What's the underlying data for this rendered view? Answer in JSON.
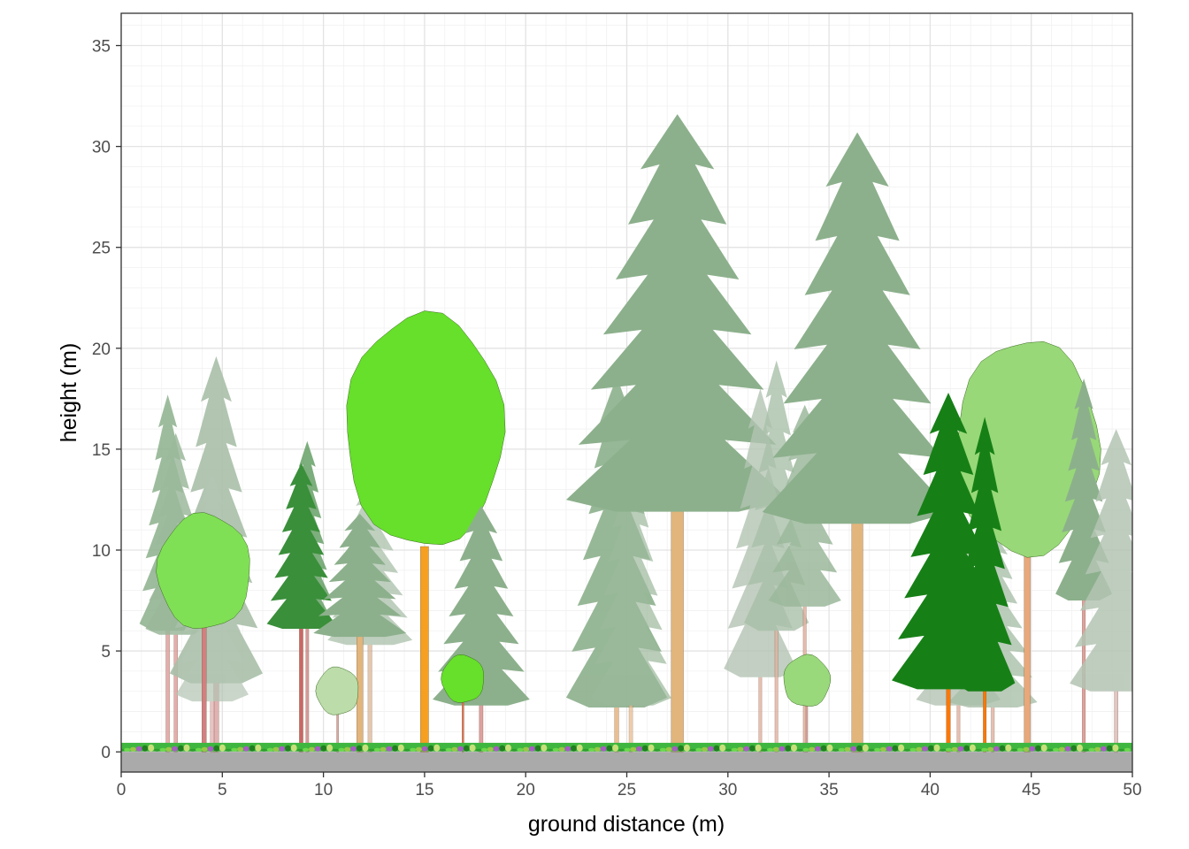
{
  "chart_data": {
    "type": "scatter",
    "title": "",
    "xlabel": "ground distance (m)",
    "ylabel": "height (m)",
    "xlim": [
      0,
      50
    ],
    "ylim": [
      -1,
      36.6
    ],
    "xticks": [
      0,
      5,
      10,
      15,
      20,
      25,
      30,
      35,
      40,
      45,
      50
    ],
    "yticks": [
      0,
      5,
      10,
      15,
      20,
      25,
      30,
      35
    ],
    "grid": true,
    "legend": "none",
    "ground": {
      "color": "#aaaaaa",
      "from": -1,
      "to": 0
    },
    "trees": [
      {
        "kind": "conifer",
        "x": 2.3,
        "h": 17.7,
        "crown_base": 6.0,
        "crown_w": 2.8,
        "color": "#8cb08c",
        "trunk": "#e0a0a0",
        "dbh": 0.18,
        "opacity": 0.85
      },
      {
        "kind": "conifer",
        "x": 2.7,
        "h": 15.8,
        "crown_base": 5.8,
        "crown_w": 3.0,
        "color": "#9bb89b",
        "trunk": "#e0a0a0",
        "dbh": 0.18,
        "opacity": 0.85
      },
      {
        "kind": "conifer",
        "x": 4.7,
        "h": 19.6,
        "crown_base": 3.4,
        "crown_w": 4.6,
        "color": "#a9bfa9",
        "trunk": "#ddaaaa",
        "dbh": 0.25,
        "opacity": 0.9
      },
      {
        "kind": "conifer",
        "x": 4.5,
        "h": 13.8,
        "crown_base": 2.5,
        "crown_w": 3.6,
        "color": "#b3c4b3",
        "trunk": "#ddaaaa",
        "dbh": 0.2,
        "opacity": 0.7
      },
      {
        "kind": "broadleaf",
        "x": 4.1,
        "h": 11.8,
        "crown_base": 6.0,
        "crown_w": 4.6,
        "color": "#80e055",
        "trunk": "#d08080",
        "dbh": 0.22,
        "opacity": 1
      },
      {
        "kind": "conifer",
        "x": 9.2,
        "h": 15.4,
        "crown_base": 6.2,
        "crown_w": 2.5,
        "color": "#5d9a5d",
        "trunk": "#cc8080",
        "dbh": 0.15,
        "opacity": 0.8
      },
      {
        "kind": "conifer",
        "x": 8.9,
        "h": 14.3,
        "crown_base": 6.1,
        "crown_w": 3.4,
        "color": "#3a8f3a",
        "trunk": "#cc6666",
        "dbh": 0.18,
        "opacity": 1
      },
      {
        "kind": "conifer",
        "x": 12.3,
        "h": 13.3,
        "crown_base": 5.3,
        "crown_w": 4.2,
        "color": "#a4bca4",
        "trunk": "#d9b090",
        "dbh": 0.2,
        "opacity": 0.7
      },
      {
        "kind": "conifer",
        "x": 11.8,
        "h": 11.8,
        "crown_base": 5.7,
        "crown_w": 4.6,
        "color": "#8cb08c",
        "trunk": "#e2b57c",
        "dbh": 0.3,
        "opacity": 1
      },
      {
        "kind": "broadleaf",
        "x": 10.7,
        "h": 4.2,
        "crown_base": 1.8,
        "crown_w": 2.1,
        "color": "#bcdcaa",
        "trunk": "#d8a8a8",
        "dbh": 0.08,
        "opacity": 1
      },
      {
        "kind": "broadleaf",
        "x": 15.0,
        "h": 21.7,
        "crown_base": 10.0,
        "crown_w": 7.8,
        "color": "#66e02a",
        "trunk": "#f5a020",
        "dbh": 0.4,
        "opacity": 1
      },
      {
        "kind": "conifer",
        "x": 17.8,
        "h": 12.2,
        "crown_base": 2.3,
        "crown_w": 4.8,
        "color": "#8cb08c",
        "trunk": "#e0a0a0",
        "dbh": 0.18,
        "opacity": 1
      },
      {
        "kind": "broadleaf",
        "x": 16.9,
        "h": 4.8,
        "crown_base": 2.4,
        "crown_w": 2.1,
        "color": "#66e02a",
        "trunk": "#e07050",
        "dbh": 0.08,
        "opacity": 1
      },
      {
        "kind": "conifer",
        "x": 24.5,
        "h": 18.6,
        "crown_base": 2.2,
        "crown_w": 5.0,
        "color": "#8cb08c",
        "trunk": "#e8b888",
        "dbh": 0.2,
        "opacity": 0.9
      },
      {
        "kind": "conifer",
        "x": 25.2,
        "h": 14.5,
        "crown_base": 2.3,
        "crown_w": 4.0,
        "color": "#9bb89b",
        "trunk": "#e8b888",
        "dbh": 0.18,
        "opacity": 0.7
      },
      {
        "kind": "conifer",
        "x": 27.5,
        "h": 31.6,
        "crown_base": 11.9,
        "crown_w": 11.0,
        "color": "#8cb08c",
        "trunk": "#e2b57c",
        "dbh": 0.6,
        "opacity": 1
      },
      {
        "kind": "conifer",
        "x": 31.6,
        "h": 18.0,
        "crown_base": 3.7,
        "crown_w": 3.6,
        "color": "#b3c4b3",
        "trunk": "#e2b0a0",
        "dbh": 0.15,
        "opacity": 0.8
      },
      {
        "kind": "conifer",
        "x": 32.4,
        "h": 19.4,
        "crown_base": 6.0,
        "crown_w": 3.2,
        "color": "#a9bfa9",
        "trunk": "#e2b0a0",
        "dbh": 0.15,
        "opacity": 0.8
      },
      {
        "kind": "conifer",
        "x": 33.8,
        "h": 17.2,
        "crown_base": 7.2,
        "crown_w": 3.6,
        "color": "#9bb89b",
        "trunk": "#e2b0a0",
        "dbh": 0.15,
        "opacity": 0.85
      },
      {
        "kind": "conifer",
        "x": 36.4,
        "h": 30.7,
        "crown_base": 11.3,
        "crown_w": 9.4,
        "color": "#8cb08c",
        "trunk": "#e2b57c",
        "dbh": 0.55,
        "opacity": 1
      },
      {
        "kind": "broadleaf",
        "x": 33.9,
        "h": 4.8,
        "crown_base": 2.2,
        "crown_w": 2.3,
        "color": "#9ad87c",
        "trunk": "#d8a8a8",
        "dbh": 0.08,
        "opacity": 1
      },
      {
        "kind": "conifer",
        "x": 41.4,
        "h": 12.0,
        "crown_base": 2.3,
        "crown_w": 4.2,
        "color": "#b3c4b3",
        "trunk": "#e2b0a0",
        "dbh": 0.15,
        "opacity": 0.8
      },
      {
        "kind": "conifer",
        "x": 43.1,
        "h": 11.0,
        "crown_base": 2.2,
        "crown_w": 4.4,
        "color": "#a9bfa9",
        "trunk": "#e2b0a0",
        "dbh": 0.15,
        "opacity": 0.8
      },
      {
        "kind": "broadleaf",
        "x": 44.8,
        "h": 20.4,
        "crown_base": 9.6,
        "crown_w": 7.1,
        "color": "#98d878",
        "trunk": "#e8a87a",
        "dbh": 0.3,
        "opacity": 1
      },
      {
        "kind": "conifer",
        "x": 40.9,
        "h": 17.8,
        "crown_base": 3.1,
        "crown_w": 5.6,
        "color": "#168016",
        "trunk": "#ff7700",
        "dbh": 0.2,
        "opacity": 1
      },
      {
        "kind": "conifer",
        "x": 42.7,
        "h": 16.6,
        "crown_base": 3.0,
        "crown_w": 3.0,
        "color": "#168016",
        "trunk": "#ff7700",
        "dbh": 0.15,
        "opacity": 1
      },
      {
        "kind": "conifer",
        "x": 47.6,
        "h": 18.5,
        "crown_base": 7.5,
        "crown_w": 2.8,
        "color": "#8cb08c",
        "trunk": "#e0a0a0",
        "dbh": 0.15,
        "opacity": 1
      },
      {
        "kind": "conifer",
        "x": 49.2,
        "h": 16.0,
        "crown_base": 3.0,
        "crown_w": 4.6,
        "color": "#b3c4b3",
        "trunk": "#ddbbbb",
        "dbh": 0.18,
        "opacity": 0.85
      }
    ]
  }
}
